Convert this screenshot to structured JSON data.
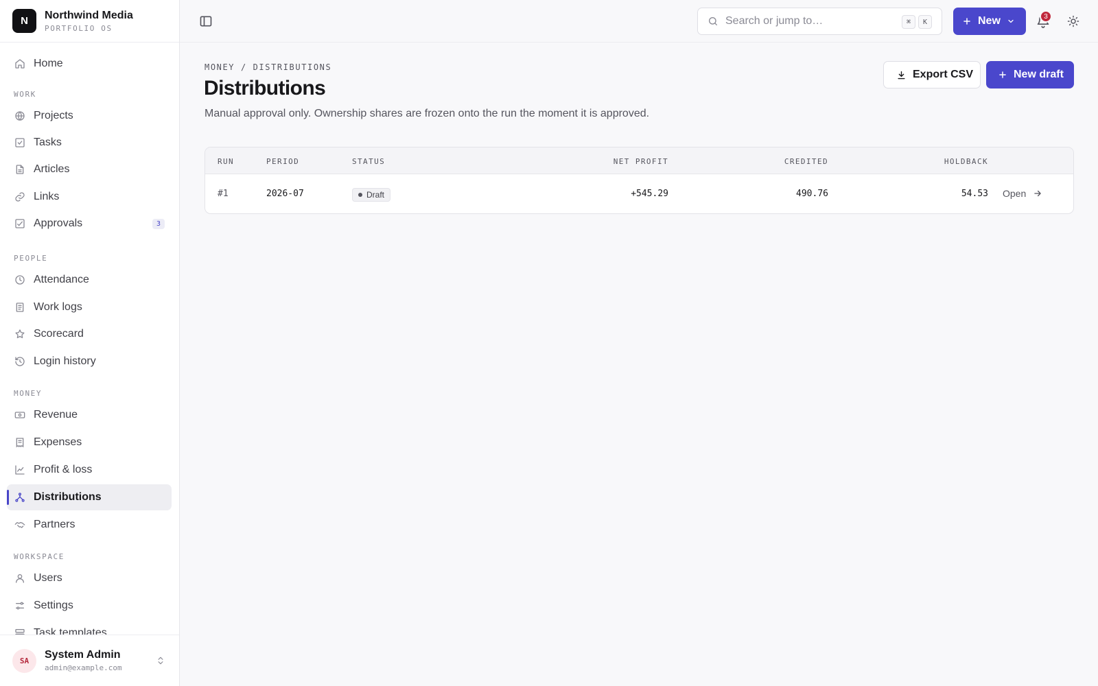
{
  "brand": {
    "logo_letter": "N",
    "name": "Northwind Media",
    "subtitle": "PORTFOLIO OS"
  },
  "nav": {
    "home": "Home",
    "sections": {
      "work": "WORK",
      "people": "PEOPLE",
      "money": "MONEY",
      "workspace": "WORKSPACE"
    },
    "work": [
      {
        "label": "Projects",
        "icon": "globe-icon"
      },
      {
        "label": "Tasks",
        "icon": "checkbox-icon"
      },
      {
        "label": "Articles",
        "icon": "file-text-icon"
      },
      {
        "label": "Links",
        "icon": "link-icon"
      },
      {
        "label": "Approvals",
        "icon": "check-square-icon",
        "badge": "3"
      }
    ],
    "people": [
      {
        "label": "Attendance",
        "icon": "clock-icon"
      },
      {
        "label": "Work logs",
        "icon": "notebook-icon"
      },
      {
        "label": "Scorecard",
        "icon": "star-icon"
      },
      {
        "label": "Login history",
        "icon": "history-icon"
      }
    ],
    "money": [
      {
        "label": "Revenue",
        "icon": "banknote-icon"
      },
      {
        "label": "Expenses",
        "icon": "receipt-icon"
      },
      {
        "label": "Profit & loss",
        "icon": "line-chart-icon"
      },
      {
        "label": "Distributions",
        "icon": "split-icon",
        "active": true
      },
      {
        "label": "Partners",
        "icon": "handshake-icon"
      }
    ],
    "workspace": [
      {
        "label": "Users",
        "icon": "user-icon"
      },
      {
        "label": "Settings",
        "icon": "sliders-icon"
      },
      {
        "label": "Task templates",
        "icon": "template-icon"
      }
    ]
  },
  "user": {
    "initials": "SA",
    "name": "System Admin",
    "email": "admin@example.com"
  },
  "topbar": {
    "search_placeholder": "Search or jump to…",
    "kbd_cmd": "⌘",
    "kbd_key": "K",
    "new_label": "New",
    "notification_count": "3"
  },
  "page": {
    "breadcrumb": "MONEY / DISTRIBUTIONS",
    "title": "Distributions",
    "description": "Manual approval only. Ownership shares are frozen onto the run the moment it is approved.",
    "export_label": "Export CSV",
    "new_draft_label": "New draft"
  },
  "table": {
    "columns": {
      "run": "RUN",
      "period": "PERIOD",
      "status": "STATUS",
      "net_profit": "NET PROFIT",
      "credited": "CREDITED",
      "holdback": "HOLDBACK"
    },
    "rows": [
      {
        "run": "#1",
        "period": "2026-07",
        "status": "Draft",
        "net_profit": "+545.29",
        "credited": "490.76",
        "holdback": "54.53",
        "action": "Open"
      }
    ]
  },
  "colors": {
    "accent": "#4a47cc",
    "badge": "#c0283c",
    "avatar_bg": "#fce7ea"
  }
}
